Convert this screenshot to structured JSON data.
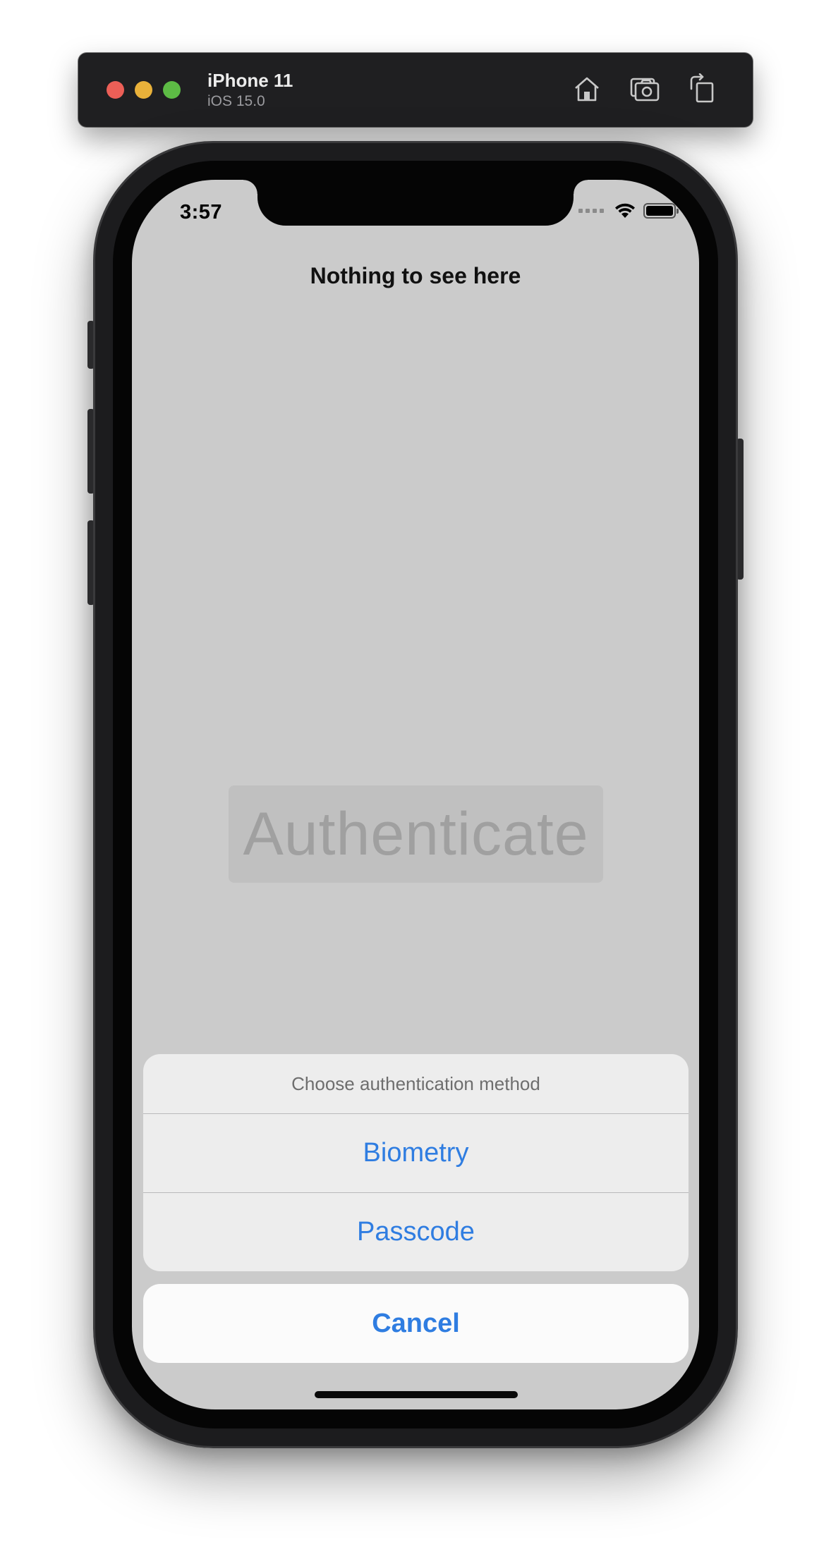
{
  "simulator": {
    "device_name": "iPhone 11",
    "os_version": "iOS 15.0",
    "toolbar_icons": [
      "home-icon",
      "screenshot-icon",
      "rotate-icon"
    ]
  },
  "status_bar": {
    "time": "3:57",
    "icons": [
      "signal-icon",
      "wifi-icon",
      "battery-icon"
    ]
  },
  "app": {
    "title": "Nothing to see here",
    "auth_button_label": "Authenticate"
  },
  "action_sheet": {
    "title": "Choose authentication method",
    "actions": [
      {
        "label": "Biometry"
      },
      {
        "label": "Passcode"
      }
    ],
    "cancel_label": "Cancel"
  },
  "colors": {
    "accent": "#2f7de1",
    "screen_background": "#cbcbcb",
    "sheet_background": "#ededed"
  }
}
